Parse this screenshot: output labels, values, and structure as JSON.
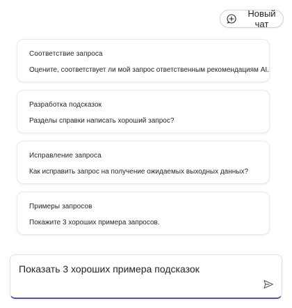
{
  "header": {
    "new_chat_label": "Новый чат",
    "new_chat_icon": "add-chat-icon"
  },
  "suggestions": [
    {
      "title": "Соответствие запроса",
      "description": "Оцените, соответствует ли мой запрос ответственным рекомендациям AI."
    },
    {
      "title": "Разработка подсказок",
      "description": "Разделы справки написать хороший запрос?"
    },
    {
      "title": "Исправление запроса",
      "description": "Как исправить запрос на получение ожидаемых выходных данных?"
    },
    {
      "title": "Примеры запросов",
      "description": "Покажите 3 хороших примера запросов."
    }
  ],
  "composer": {
    "value": "Показать 3 хороших примера подсказок",
    "send_icon": "send-icon"
  },
  "colors": {
    "accent": "#4f52b2"
  }
}
